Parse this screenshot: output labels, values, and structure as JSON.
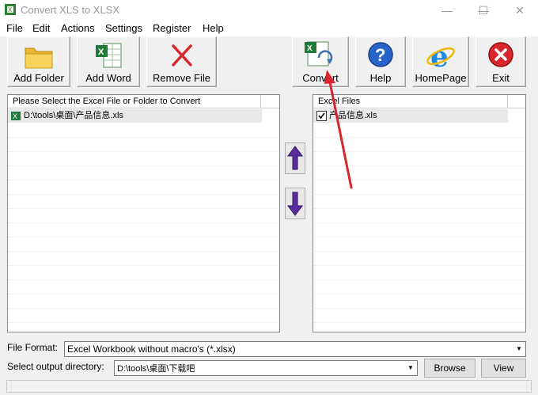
{
  "window": {
    "title": "Convert XLS to XLSX",
    "controls": [
      "—",
      "☐",
      "✕"
    ]
  },
  "menu": [
    "File",
    "Edit",
    "Actions",
    "Settings",
    "Register",
    "Help"
  ],
  "toolbar": {
    "add_folder": "Add Folder",
    "add_word": "Add Word",
    "remove_file": "Remove File",
    "convert": "Convert",
    "help": "Help",
    "homepage": "HomePage",
    "exit": "Exit"
  },
  "left_panel": {
    "header": "Please Select the Excel File or Folder to Convert",
    "items": [
      "D:\\tools\\桌面\\产品信息.xls"
    ]
  },
  "right_panel": {
    "header": "Excel Files",
    "items": [
      {
        "name": "产品信息.xls",
        "checked": true
      }
    ]
  },
  "bottom": {
    "format_label": "File Format:",
    "format_value": "Excel Workbook without macro's (*.xlsx)",
    "output_label": "Select  output directory:",
    "output_value": "D:\\tools\\桌面\\下载吧",
    "browse": "Browse",
    "view": "View"
  },
  "colors": {
    "accent_red": "#d9262c",
    "arrow_purple": "#5b2ca0"
  }
}
